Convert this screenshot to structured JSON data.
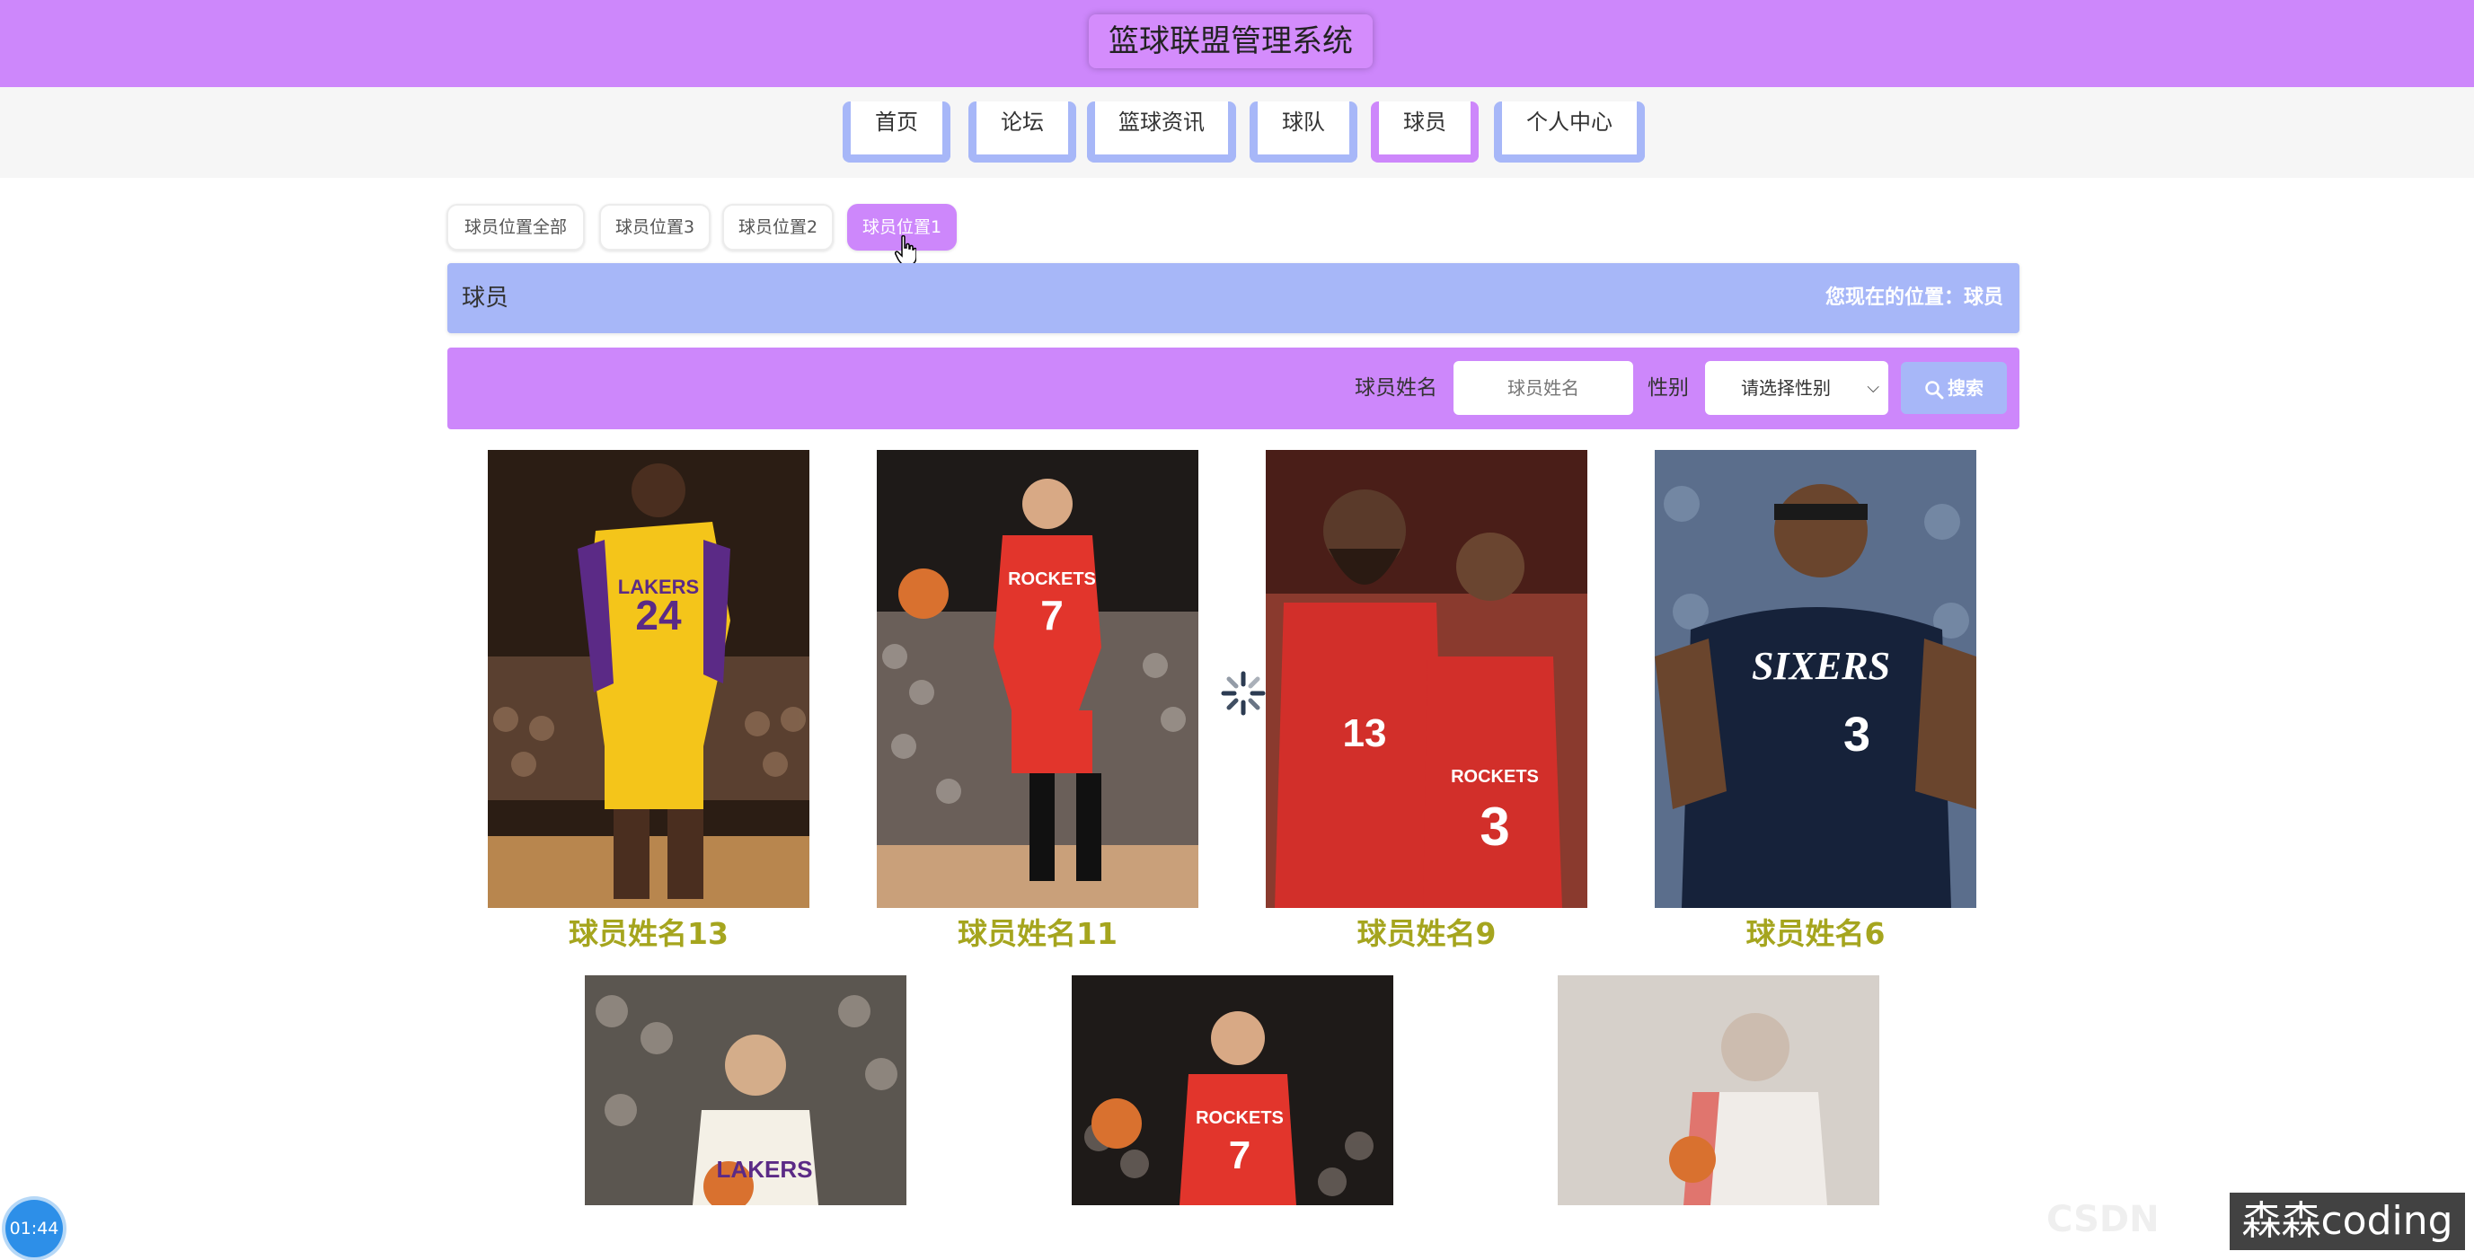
{
  "header": {
    "title": "篮球联盟管理系统"
  },
  "nav": {
    "items": [
      {
        "label": "首页"
      },
      {
        "label": "论坛"
      },
      {
        "label": "篮球资讯"
      },
      {
        "label": "球队"
      },
      {
        "label": "球员"
      },
      {
        "label": "个人中心"
      }
    ],
    "active": "球员"
  },
  "categories": [
    {
      "label": "球员位置全部"
    },
    {
      "label": "球员位置3"
    },
    {
      "label": "球员位置2"
    },
    {
      "label": "球员位置1"
    }
  ],
  "breadcrumb": {
    "title": "球员",
    "location": "您现在的位置：球员"
  },
  "search": {
    "name_label": "球员姓名",
    "name_placeholder": "球员姓名",
    "gender_label": "性别",
    "gender_value": "请选择性别",
    "button_label": "搜索"
  },
  "players": [
    {
      "name": "球员姓名13",
      "jersey": "24",
      "team": "LAKERS"
    },
    {
      "name": "球员姓名11",
      "jersey": "7",
      "team": "ROCKETS"
    },
    {
      "name": "球员姓名9",
      "jersey": "3",
      "team": "ROCKETS"
    },
    {
      "name": "球员姓名6",
      "jersey": "3",
      "team": "SIXERS"
    }
  ],
  "players_row2": [
    {
      "team": "LAKERS"
    },
    {
      "jersey": "7",
      "team": "ROCKETS"
    },
    {
      "team": ""
    }
  ],
  "overlay": {
    "timer": "01:44",
    "watermark": "森森coding",
    "ghost": "CSDN"
  },
  "colors": {
    "primary": "#cd87fb",
    "secondary": "#a7b7f8",
    "name_text": "#a5a51e"
  }
}
